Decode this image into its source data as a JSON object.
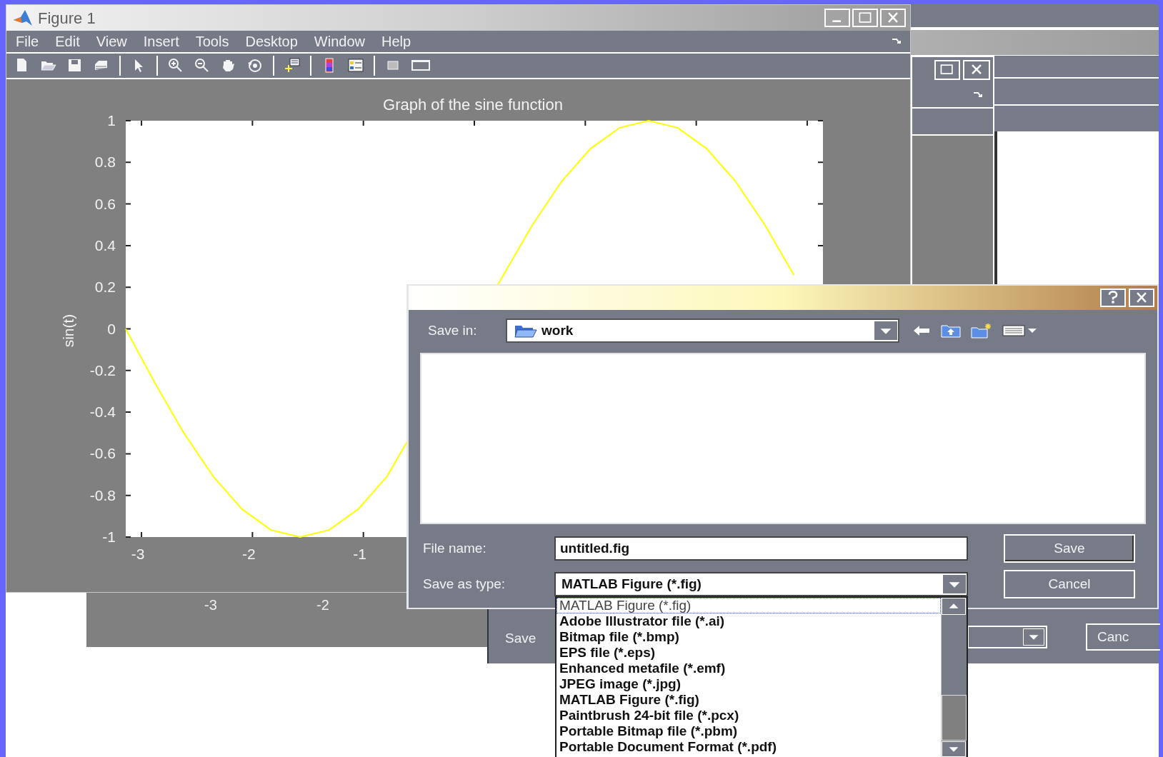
{
  "figure_window": {
    "title": "Figure 1",
    "menu": [
      "File",
      "Edit",
      "View",
      "Insert",
      "Tools",
      "Desktop",
      "Window",
      "Help"
    ]
  },
  "plot": {
    "chart_data": {
      "type": "line",
      "title": "Graph of the sine function",
      "ylabel": "sin(t)",
      "x": [
        -3.142,
        -2.88,
        -2.618,
        -2.356,
        -2.094,
        -1.833,
        -1.571,
        -1.309,
        -1.047,
        -0.785,
        0.262,
        0.524,
        0.785,
        1.047,
        1.309,
        1.571,
        1.833,
        2.094,
        2.356,
        2.618,
        2.88
      ],
      "series": [
        {
          "color": "#ffff00",
          "values": [
            0,
            -0.259,
            -0.5,
            -0.707,
            -0.866,
            -0.966,
            -1,
            -0.966,
            -0.866,
            -0.707,
            0.259,
            0.5,
            0.707,
            0.866,
            0.966,
            1,
            0.966,
            0.866,
            0.707,
            0.5,
            0.259
          ]
        }
      ],
      "xlim": [
        -3.142,
        3.142
      ],
      "ylim": [
        -1,
        1
      ],
      "xticks": [
        -3,
        -2,
        -1
      ],
      "yticks": [
        1,
        0.8,
        0.6,
        0.4,
        0.2,
        0,
        -0.2,
        -0.4,
        -0.6,
        -0.8,
        -1
      ]
    }
  },
  "background_figure": {
    "xtick_labels": [
      "-3",
      "-2"
    ]
  },
  "background_dialog": {
    "label": "Save",
    "cancel_button": "Canc"
  },
  "save_dialog": {
    "save_in_label": "Save in:",
    "folder": "work",
    "file_name_label": "File name:",
    "file_name": "untitled.fig",
    "save_as_type_label": "Save as type:",
    "save_as_type": "MATLAB Figure (*.fig)",
    "save_button": "Save",
    "cancel_button": "Cancel",
    "type_list": [
      {
        "label": "MATLAB Figure (*.fig)",
        "selected": true
      },
      {
        "label": "Adobe Illustrator file (*.ai)",
        "selected": false
      },
      {
        "label": "Bitmap file (*.bmp)",
        "selected": false
      },
      {
        "label": "EPS file (*.eps)",
        "selected": false
      },
      {
        "label": "Enhanced metafile (*.emf)",
        "selected": false
      },
      {
        "label": "JPEG image (*.jpg)",
        "selected": false
      },
      {
        "label": "MATLAB Figure (*.fig)",
        "selected": false
      },
      {
        "label": "Paintbrush 24-bit file (*.pcx)",
        "selected": false
      },
      {
        "label": "Portable Bitmap file (*.pbm)",
        "selected": false
      },
      {
        "label": "Portable Document Format (*.pdf)",
        "selected": false
      }
    ]
  }
}
